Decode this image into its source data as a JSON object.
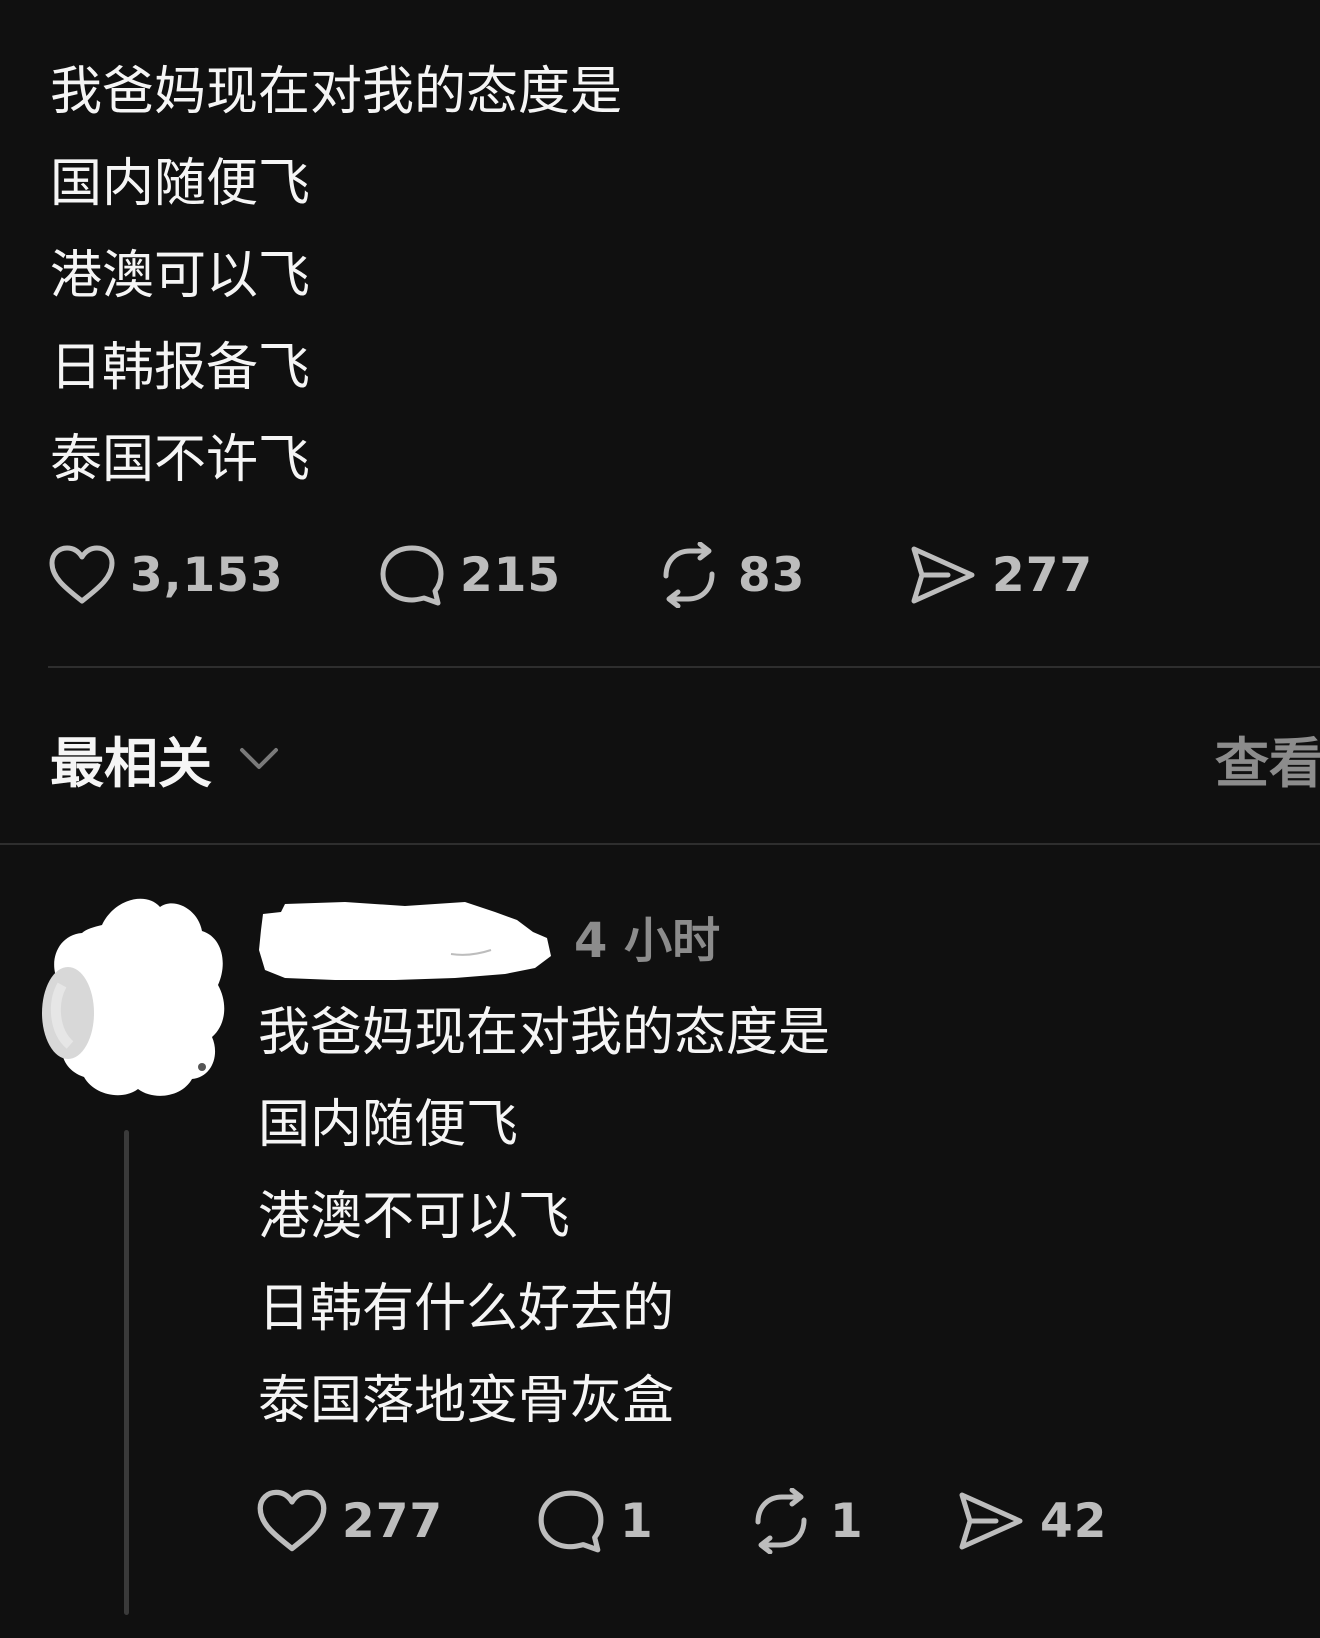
{
  "post": {
    "lines": [
      "我爸妈现在对我的态度是",
      "国内随便飞",
      "港澳可以飞",
      "日韩报备飞",
      "泰国不许飞"
    ],
    "likes": "3,153",
    "comments": "215",
    "reposts": "83",
    "shares": "277"
  },
  "replies_header": {
    "sort_label": "最相关",
    "view_label": "查看"
  },
  "reply": {
    "time": "4 小时",
    "lines": [
      "我爸妈现在对我的态度是",
      "国内随便飞",
      "港澳不可以飞",
      "日韩有什么好去的",
      "泰国落地变骨灰盒"
    ],
    "likes": "277",
    "comments": "1",
    "reposts": "1",
    "shares": "42"
  },
  "colors": {
    "background": "#101010",
    "text": "#f5f5f5",
    "muted": "#8c8c8c",
    "divider": "#2e2e2e"
  },
  "icons": [
    "heart-icon",
    "comment-icon",
    "repost-icon",
    "share-icon",
    "chevron-down-icon"
  ]
}
